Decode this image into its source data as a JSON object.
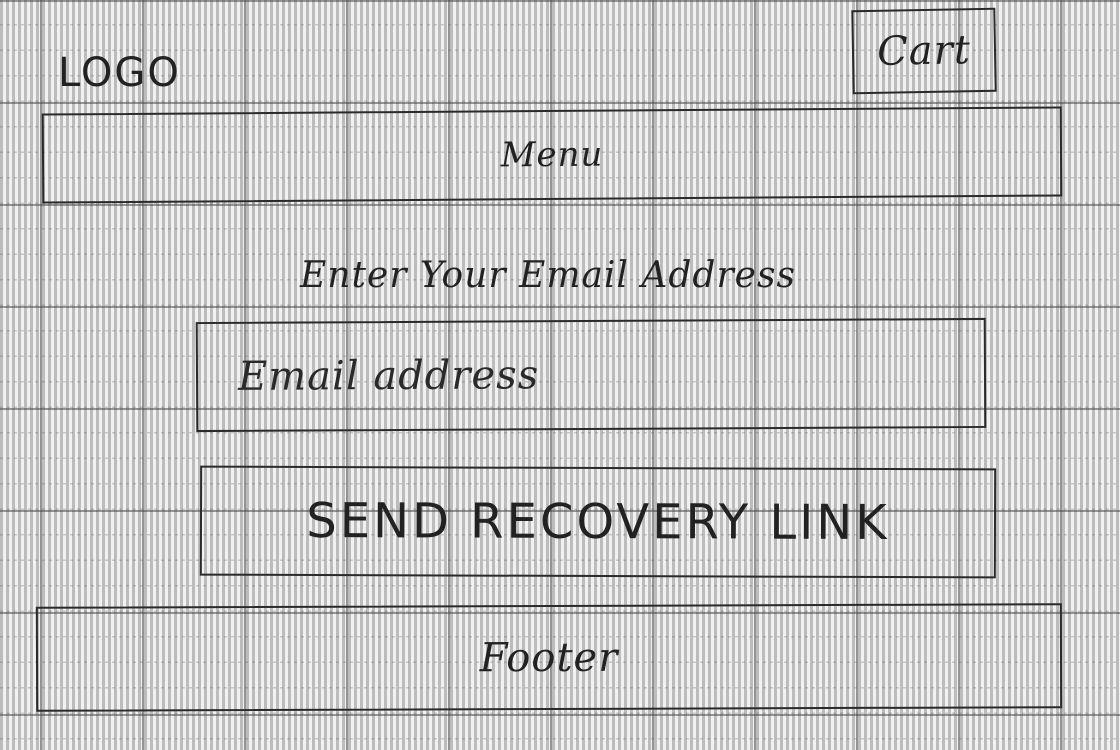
{
  "header": {
    "logo_text": "LOGO",
    "cart_label": "Cart"
  },
  "nav": {
    "menu_label": "Menu"
  },
  "recovery_form": {
    "heading": "Enter Your Email Address",
    "email_placeholder": "Email address",
    "submit_label": "SEND RECOVERY LINK"
  },
  "footer": {
    "label": "Footer"
  },
  "colors": {
    "paper": "#f1f1f1",
    "ink": "#222222",
    "grid": "#8a8a8a"
  }
}
